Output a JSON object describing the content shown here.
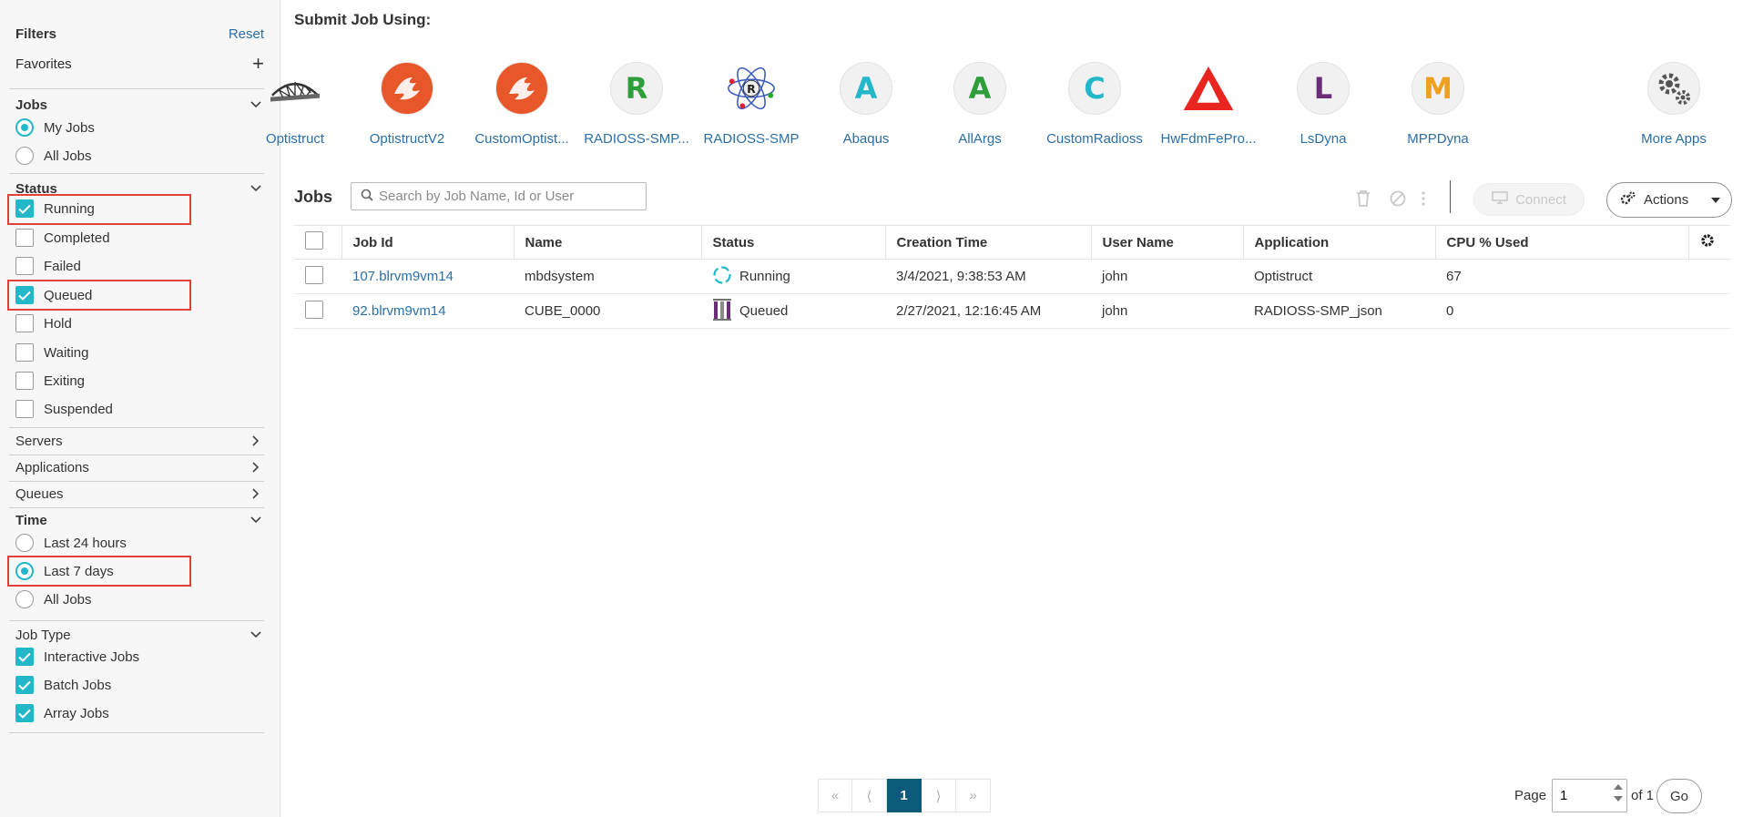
{
  "sidebar": {
    "title": "Filters",
    "reset": "Reset",
    "favorites": "Favorites",
    "jobs": {
      "label": "Jobs",
      "options": [
        "My Jobs",
        "All Jobs"
      ],
      "selected": "My Jobs"
    },
    "status": {
      "label": "Status",
      "items": [
        {
          "label": "Running",
          "checked": true
        },
        {
          "label": "Completed",
          "checked": false
        },
        {
          "label": "Failed",
          "checked": false
        },
        {
          "label": "Queued",
          "checked": true
        },
        {
          "label": "Hold",
          "checked": false
        },
        {
          "label": "Waiting",
          "checked": false
        },
        {
          "label": "Exiting",
          "checked": false
        },
        {
          "label": "Suspended",
          "checked": false
        }
      ]
    },
    "servers": "Servers",
    "applications": "Applications",
    "queues": "Queues",
    "time": {
      "label": "Time",
      "options": [
        "Last 24 hours",
        "Last 7 days",
        "All Jobs"
      ],
      "selected": "Last 7 days"
    },
    "job_type": {
      "label": "Job Type",
      "items": [
        {
          "label": "Interactive Jobs",
          "checked": true
        },
        {
          "label": "Batch Jobs",
          "checked": true
        },
        {
          "label": "Array Jobs",
          "checked": true
        }
      ]
    }
  },
  "submit": {
    "title": "Submit Job Using:",
    "apps": [
      {
        "name": "Optistruct",
        "icon": "bridge-icon"
      },
      {
        "name": "OptistructV2",
        "icon": "altair-logo-icon"
      },
      {
        "name": "CustomOptist...",
        "icon": "altair-logo-icon"
      },
      {
        "name": "RADIOSS-SMP...",
        "icon": "letter-icon",
        "letter": "R",
        "color": "#2e9e3a"
      },
      {
        "name": "RADIOSS-SMP",
        "icon": "atom-icon"
      },
      {
        "name": "Abaqus",
        "icon": "letter-icon",
        "letter": "A",
        "color": "#22b8c9"
      },
      {
        "name": "AllArgs",
        "icon": "letter-icon",
        "letter": "A",
        "color": "#2e9e3a"
      },
      {
        "name": "CustomRadioss",
        "icon": "letter-icon",
        "letter": "C",
        "color": "#22b8c9"
      },
      {
        "name": "HwFdmFePro...",
        "icon": "triangle-logo-icon"
      },
      {
        "name": "LsDyna",
        "icon": "letter-icon",
        "letter": "L",
        "color": "#6b2c7a"
      },
      {
        "name": "MPPDyna",
        "icon": "letter-icon",
        "letter": "M",
        "color": "#f0a020"
      }
    ],
    "more_apps": "More Apps"
  },
  "jobs": {
    "title": "Jobs",
    "search_placeholder": "Search by Job Name, Id or User",
    "connect": "Connect",
    "actions": "Actions",
    "columns": [
      "Job Id",
      "Name",
      "Status",
      "Creation Time",
      "User Name",
      "Application",
      "CPU % Used"
    ],
    "rows": [
      {
        "id": "107.blrvm9vm14",
        "name": "mbdsystem",
        "status": "Running",
        "created": "3/4/2021, 9:38:53 AM",
        "user": "john",
        "app": "Optistruct",
        "cpu": "67"
      },
      {
        "id": "92.blrvm9vm14",
        "name": "CUBE_0000",
        "status": "Queued",
        "created": "2/27/2021, 12:16:45 AM",
        "user": "john",
        "app": "RADIOSS-SMP_json",
        "cpu": "0"
      }
    ]
  },
  "pagination": {
    "first": "«",
    "prev": "⟨",
    "current": "1",
    "next": "⟩",
    "last": "»",
    "page_label": "Page",
    "page_value": "1",
    "of_label": "of 1",
    "go": "Go"
  },
  "colors": {
    "accent": "#22b8c9",
    "link": "#2a6fa8",
    "highlight": "#e0413a",
    "active_page": "#0b5a7a"
  }
}
